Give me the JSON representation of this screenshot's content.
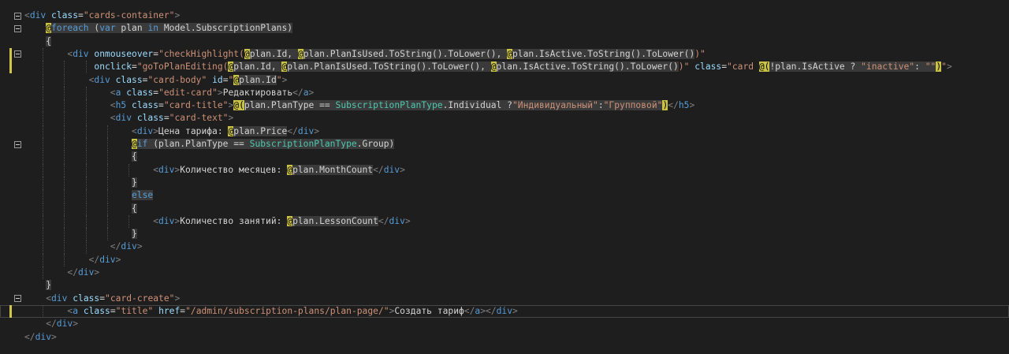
{
  "editor": {
    "language": "razor",
    "lines": [
      [
        [
          "p",
          "<"
        ],
        [
          "t",
          "div"
        ],
        [
          "tx",
          " "
        ],
        [
          "a",
          "class"
        ],
        [
          "tx",
          "="
        ],
        [
          "s",
          "\"cards-container\""
        ],
        [
          "p",
          ">"
        ]
      ],
      [
        [
          "at",
          "@"
        ],
        [
          "hi-k",
          "foreach"
        ],
        [
          "hi",
          " ("
        ],
        [
          "hi-k",
          "var"
        ],
        [
          "hi",
          " plan "
        ],
        [
          "hi-k",
          "in"
        ],
        [
          "hi",
          " Model.SubscriptionPlans)"
        ]
      ],
      [
        [
          "hi",
          "{"
        ]
      ],
      [
        [
          "p",
          "<"
        ],
        [
          "t",
          "div"
        ],
        [
          "tx",
          " "
        ],
        [
          "a",
          "onmouseover"
        ],
        [
          "tx",
          "="
        ],
        [
          "s",
          "\"checkHighlight("
        ],
        [
          "at",
          "@"
        ],
        [
          "hi",
          "plan.Id, "
        ],
        [
          "at",
          "@"
        ],
        [
          "hi",
          "plan.PlanIsUsed.ToString().ToLower(), "
        ],
        [
          "at",
          "@"
        ],
        [
          "hi",
          "plan.IsActive.ToString().ToLower()"
        ],
        [
          "s",
          ")\""
        ]
      ],
      [
        [
          "a",
          "onclick"
        ],
        [
          "tx",
          "="
        ],
        [
          "s",
          "\"goToPlanEditing("
        ],
        [
          "at",
          "@"
        ],
        [
          "hi",
          "plan.Id, "
        ],
        [
          "at",
          "@"
        ],
        [
          "hi",
          "plan.PlanIsUsed.ToString().ToLower(), "
        ],
        [
          "at",
          "@"
        ],
        [
          "hi",
          "plan.IsActive.ToString().ToLower()"
        ],
        [
          "s",
          ")\""
        ],
        [
          "tx",
          " "
        ],
        [
          "a",
          "class"
        ],
        [
          "tx",
          "="
        ],
        [
          "s",
          "\"card "
        ],
        [
          "at",
          "@("
        ],
        [
          "hi",
          "!plan.IsActive ? "
        ],
        [
          "hi-cv",
          "\"inactive\""
        ],
        [
          "hi",
          ": "
        ],
        [
          "hi-cv",
          "\"\""
        ],
        [
          "at",
          ")"
        ],
        [
          "s",
          "\""
        ],
        [
          "p",
          ">"
        ]
      ],
      [
        [
          "p",
          "<"
        ],
        [
          "t",
          "div"
        ],
        [
          "tx",
          " "
        ],
        [
          "a",
          "class"
        ],
        [
          "tx",
          "="
        ],
        [
          "s",
          "\"card-body\""
        ],
        [
          "tx",
          " "
        ],
        [
          "a",
          "id"
        ],
        [
          "tx",
          "="
        ],
        [
          "s",
          "\""
        ],
        [
          "at",
          "@"
        ],
        [
          "hi",
          "plan.Id"
        ],
        [
          "s",
          "\""
        ],
        [
          "p",
          ">"
        ]
      ],
      [
        [
          "p",
          "<"
        ],
        [
          "t",
          "a"
        ],
        [
          "tx",
          " "
        ],
        [
          "a",
          "class"
        ],
        [
          "tx",
          "="
        ],
        [
          "s",
          "\"edit-card\""
        ],
        [
          "p",
          ">"
        ],
        [
          "tx",
          "Редактировать"
        ],
        [
          "p",
          "</"
        ],
        [
          "t",
          "a"
        ],
        [
          "p",
          ">"
        ]
      ],
      [
        [
          "p",
          "<"
        ],
        [
          "t",
          "h5"
        ],
        [
          "tx",
          " "
        ],
        [
          "a",
          "class"
        ],
        [
          "tx",
          "="
        ],
        [
          "s",
          "\"card-title\""
        ],
        [
          "p",
          ">"
        ],
        [
          "at",
          "@("
        ],
        [
          "hi",
          "plan.PlanType == "
        ],
        [
          "hi-ty",
          "SubscriptionPlanType"
        ],
        [
          "hi",
          ".Individual ?"
        ],
        [
          "hi-cv",
          "\"Индивидуальный\""
        ],
        [
          "hi",
          ":"
        ],
        [
          "hi-cv",
          "\"Групповой\""
        ],
        [
          "at",
          ")"
        ],
        [
          "p",
          "</"
        ],
        [
          "t",
          "h5"
        ],
        [
          "p",
          ">"
        ]
      ],
      [
        [
          "p",
          "<"
        ],
        [
          "t",
          "div"
        ],
        [
          "tx",
          " "
        ],
        [
          "a",
          "class"
        ],
        [
          "tx",
          "="
        ],
        [
          "s",
          "\"card-text\""
        ],
        [
          "p",
          ">"
        ]
      ],
      [
        [
          "p",
          "<"
        ],
        [
          "t",
          "div"
        ],
        [
          "p",
          ">"
        ],
        [
          "tx",
          "Цена тарифа: "
        ],
        [
          "at",
          "@"
        ],
        [
          "hi",
          "plan.Price"
        ],
        [
          "p",
          "</"
        ],
        [
          "t",
          "div"
        ],
        [
          "p",
          ">"
        ]
      ],
      [
        [
          "at",
          "@"
        ],
        [
          "hi-k",
          "if"
        ],
        [
          "hi",
          " (plan.PlanType == "
        ],
        [
          "hi-ty",
          "SubscriptionPlanType"
        ],
        [
          "hi",
          ".Group)"
        ]
      ],
      [
        [
          "hi",
          "{"
        ]
      ],
      [
        [
          "p",
          "<"
        ],
        [
          "t",
          "div"
        ],
        [
          "p",
          ">"
        ],
        [
          "tx",
          "Количество месяцев: "
        ],
        [
          "at",
          "@"
        ],
        [
          "hi",
          "plan.MonthCount"
        ],
        [
          "p",
          "</"
        ],
        [
          "t",
          "div"
        ],
        [
          "p",
          ">"
        ]
      ],
      [
        [
          "hi",
          "}"
        ]
      ],
      [
        [
          "hi-k",
          "else"
        ]
      ],
      [
        [
          "hi",
          "{"
        ]
      ],
      [
        [
          "p",
          "<"
        ],
        [
          "t",
          "div"
        ],
        [
          "p",
          ">"
        ],
        [
          "tx",
          "Количество занятий: "
        ],
        [
          "at",
          "@"
        ],
        [
          "hi",
          "plan.LessonCount"
        ],
        [
          "p",
          "</"
        ],
        [
          "t",
          "div"
        ],
        [
          "p",
          ">"
        ]
      ],
      [
        [
          "hi",
          "}"
        ]
      ],
      [
        [
          "p",
          "</"
        ],
        [
          "t",
          "div"
        ],
        [
          "p",
          ">"
        ]
      ],
      [
        [
          "p",
          "</"
        ],
        [
          "t",
          "div"
        ],
        [
          "p",
          ">"
        ]
      ],
      [
        [
          "p",
          "</"
        ],
        [
          "t",
          "div"
        ],
        [
          "p",
          ">"
        ]
      ],
      [
        [
          "hi",
          "}"
        ]
      ],
      [
        [
          "p",
          "<"
        ],
        [
          "t",
          "div"
        ],
        [
          "tx",
          " "
        ],
        [
          "a",
          "class"
        ],
        [
          "tx",
          "="
        ],
        [
          "s",
          "\"card-create\""
        ],
        [
          "p",
          ">"
        ]
      ],
      [
        [
          "p",
          "<"
        ],
        [
          "t",
          "a"
        ],
        [
          "tx",
          " "
        ],
        [
          "a",
          "class"
        ],
        [
          "tx",
          "="
        ],
        [
          "s",
          "\"title\""
        ],
        [
          "tx",
          " "
        ],
        [
          "a",
          "href"
        ],
        [
          "tx",
          "="
        ],
        [
          "s",
          "\"/admin/subscription-plans/plan-page/\""
        ],
        [
          "p",
          ">"
        ],
        [
          "tx",
          "Создать тариф"
        ],
        [
          "p",
          "</"
        ],
        [
          "t",
          "a"
        ],
        [
          "p",
          "></"
        ],
        [
          "t",
          "div"
        ],
        [
          "p",
          ">"
        ]
      ],
      [
        [
          "p",
          "</"
        ],
        [
          "t",
          "div"
        ],
        [
          "p",
          ">"
        ]
      ],
      [
        [
          "p",
          "</"
        ],
        [
          "t",
          "div"
        ],
        [
          "p",
          ">"
        ]
      ]
    ]
  }
}
